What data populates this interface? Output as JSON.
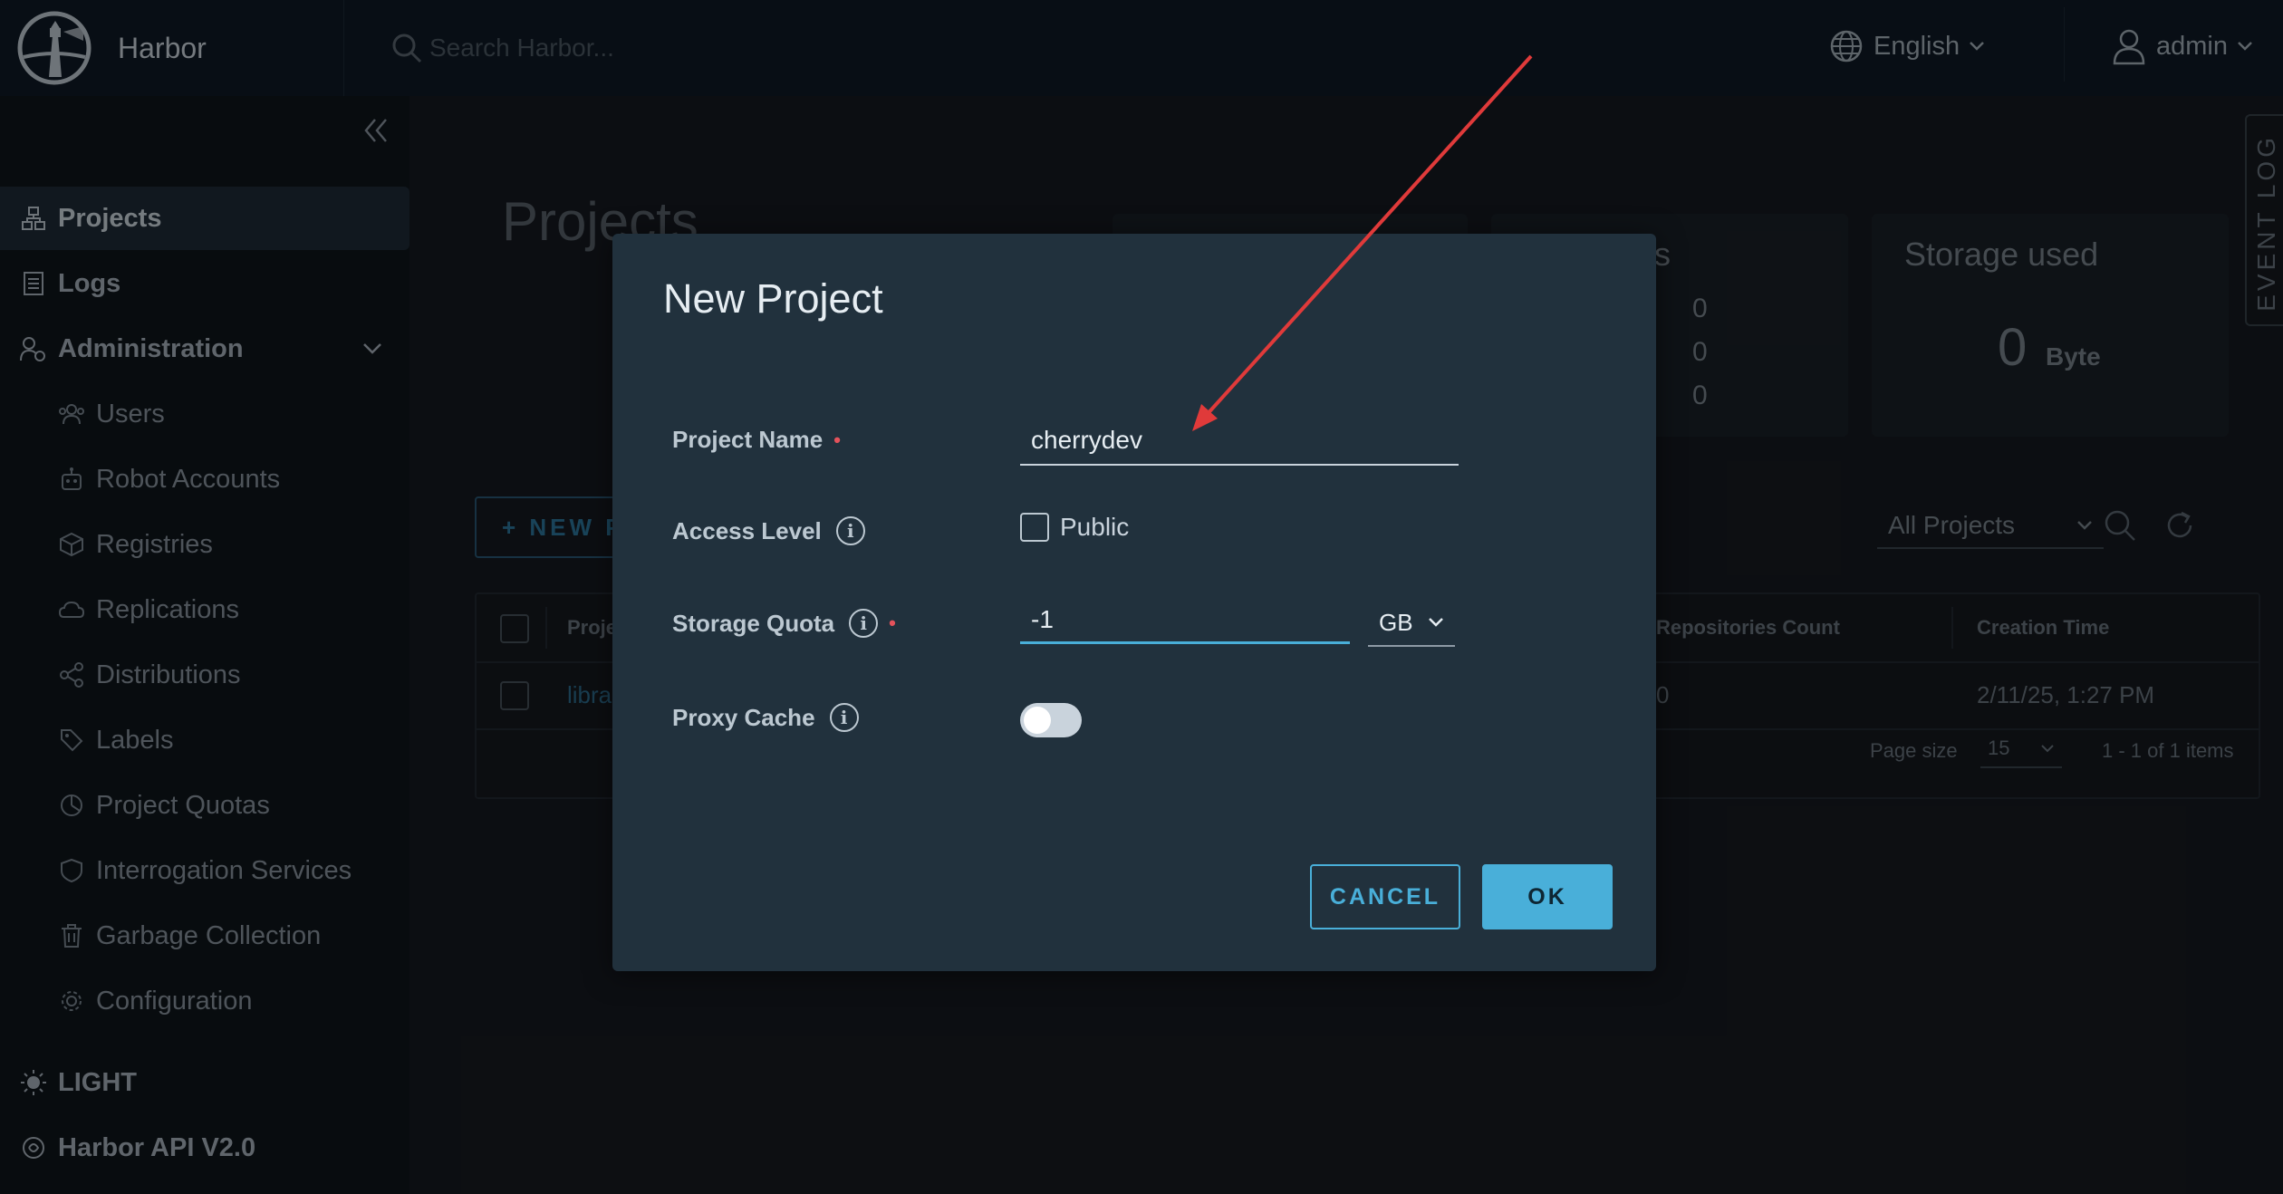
{
  "app": {
    "name": "Harbor"
  },
  "header": {
    "search_placeholder": "Search Harbor...",
    "language": "English",
    "user": "admin"
  },
  "sidebar": {
    "items": [
      {
        "label": "Projects",
        "icon": "projects-icon"
      },
      {
        "label": "Logs",
        "icon": "logs-icon"
      },
      {
        "label": "Administration",
        "icon": "administration-icon"
      },
      {
        "label": "Users",
        "icon": "users-icon"
      },
      {
        "label": "Robot Accounts",
        "icon": "robot-icon"
      },
      {
        "label": "Registries",
        "icon": "registries-icon"
      },
      {
        "label": "Replications",
        "icon": "replications-icon"
      },
      {
        "label": "Distributions",
        "icon": "distributions-icon"
      },
      {
        "label": "Labels",
        "icon": "labels-icon"
      },
      {
        "label": "Project Quotas",
        "icon": "quotas-icon"
      },
      {
        "label": "Interrogation Services",
        "icon": "shield-icon"
      },
      {
        "label": "Garbage Collection",
        "icon": "trash-icon"
      },
      {
        "label": "Configuration",
        "icon": "gear-icon"
      }
    ],
    "theme_toggle": "LIGHT",
    "api_link": "Harbor API V2.0"
  },
  "page": {
    "title": "Projects",
    "repositories_partial": "ries",
    "counts": [
      "0",
      "0",
      "0"
    ],
    "storage_title": "Storage used",
    "storage_value": "0",
    "storage_unit": "Byte",
    "new_button_partial": "+ NEW P",
    "filter": "All Projects",
    "table": {
      "col_name_partial": "Proje",
      "col_repos": "Repositories Count",
      "col_created": "Creation Time",
      "row_name_partial": "libra",
      "row_repos": "0",
      "row_created": "2/11/25, 1:27 PM",
      "page_size_label": "Page size",
      "page_size": "15",
      "items_text": "1 - 1 of 1 items"
    },
    "event_log": "EVENT LOG"
  },
  "modal": {
    "title": "New Project",
    "project_name_label": "Project Name",
    "project_name_value": "cherrydev",
    "access_level_label": "Access Level",
    "public_label": "Public",
    "public_checked": false,
    "storage_quota_label": "Storage Quota",
    "storage_quota_value": "-1",
    "storage_unit": "GB",
    "proxy_cache_label": "Proxy Cache",
    "proxy_cache_enabled": false,
    "cancel_label": "CANCEL",
    "ok_label": "OK"
  },
  "colors": {
    "accent": "#49afd9",
    "required": "#e4525b",
    "annotation_arrow": "#e03a3a"
  }
}
